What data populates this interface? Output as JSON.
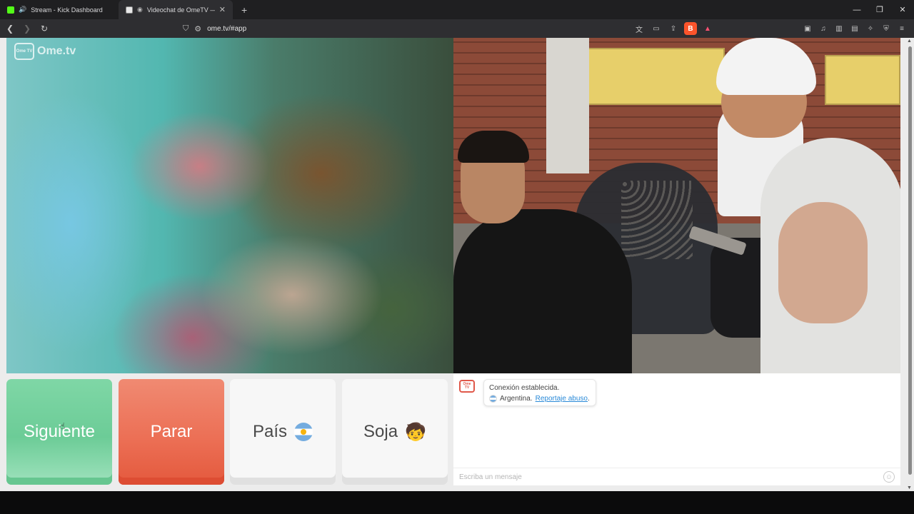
{
  "browser": {
    "tabs": [
      {
        "title": "Stream - Kick Dashboard",
        "active": false
      },
      {
        "title": "Videochat de OmeTV — Alte",
        "active": true
      }
    ],
    "new_tab": "+",
    "url": "ome.tv/#app",
    "window_controls": [
      "—",
      "❐",
      "✕"
    ]
  },
  "app": {
    "logo_badge": "Ome TV",
    "logo_text": "Ome.tv"
  },
  "controls": {
    "next_label": "Siguiente",
    "stop_label": "Parar",
    "country_label": "País",
    "gender_label": "Soja",
    "gender_icon": "🧒"
  },
  "chat": {
    "avatar_badge": "Ome TV",
    "status_message": "Conexión establecida.",
    "country_name": "Argentina.",
    "report_link": "Reportaje abuso",
    "report_suffix": ".",
    "input_placeholder": "Escriba un mensaje"
  },
  "colors": {
    "next": "#6ccc97",
    "stop": "#ec7056",
    "link": "#2a8ad8"
  }
}
